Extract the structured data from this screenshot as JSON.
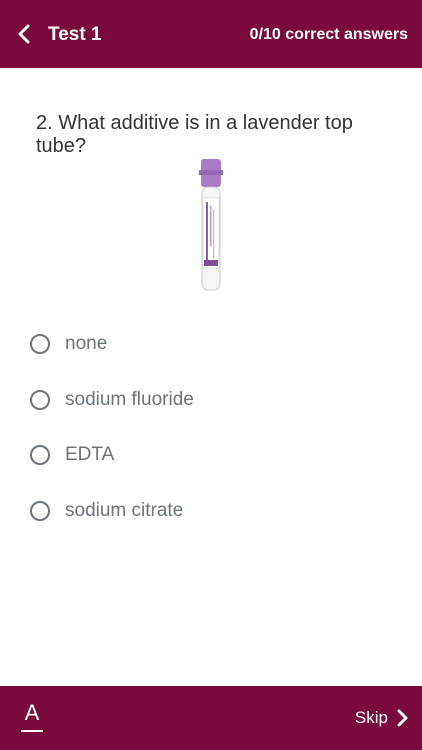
{
  "header": {
    "title": "Test 1",
    "score": "0/10 correct answers",
    "back_icon": "chevron-left-icon"
  },
  "question": {
    "text": "2. What additive is in a lavender top tube?",
    "image": "lavender-top-blood-tube"
  },
  "options": [
    {
      "label": "none",
      "selected": false
    },
    {
      "label": "sodium fluoride",
      "selected": false
    },
    {
      "label": "EDTA",
      "selected": false
    },
    {
      "label": "sodium citrate",
      "selected": false
    }
  ],
  "footer": {
    "font_icon_label": "A",
    "skip_label": "Skip",
    "skip_icon": "chevron-right-icon"
  },
  "colors": {
    "brand": "#7a0a3b",
    "option_text": "#6c7379",
    "tube_cap": "#a97cc6"
  }
}
